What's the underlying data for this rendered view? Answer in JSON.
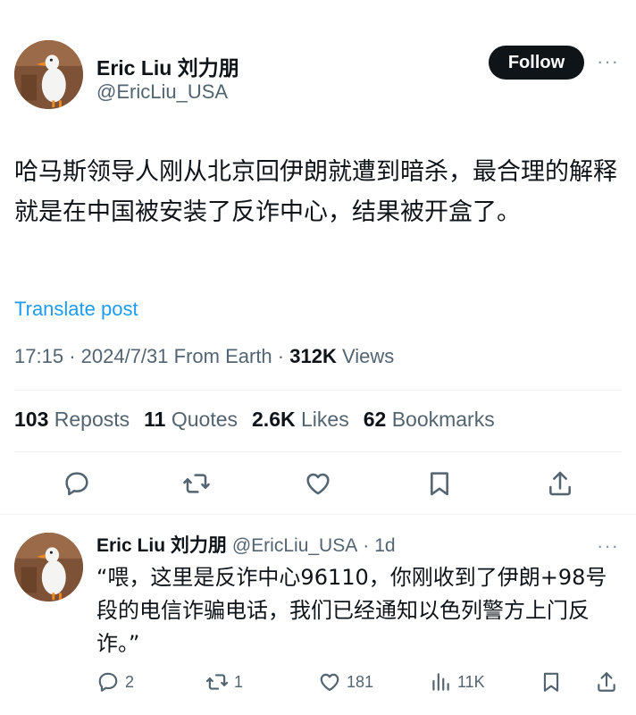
{
  "post": {
    "author": {
      "name": "Eric Liu 刘力朋",
      "handle": "@EricLiu_USA"
    },
    "follow_label": "Follow",
    "text": "哈马斯领导人刚从北京回伊朗就遭到暗杀，最合理的解释就是在中国被安装了反诈中心，结果被开盒了。",
    "translate_label": "Translate post",
    "meta": {
      "time": "17:15",
      "date": "2024/7/31",
      "source": "From Earth",
      "views_count": "312K",
      "views_label": "Views"
    },
    "stats": {
      "reposts": "103",
      "reposts_label": "Reposts",
      "quotes": "11",
      "quotes_label": "Quotes",
      "likes": "2.6K",
      "likes_label": "Likes",
      "bookmarks": "62",
      "bookmarks_label": "Bookmarks"
    },
    "actions": [
      "reply-icon",
      "repost-icon",
      "like-icon",
      "bookmark-icon",
      "share-icon"
    ]
  },
  "reply": {
    "author": {
      "name": "Eric Liu 刘力朋",
      "handle": "@EricLiu_USA",
      "age": "1d"
    },
    "text": "“喂，这里是反诈中心96110，你刚收到了伊朗+98号段的电信诈骗电话，我们已经通知以色列警方上门反诈。”",
    "counts": {
      "replies": "2",
      "reposts": "1",
      "likes": "181",
      "views": "11K"
    }
  },
  "colors": {
    "text": "#0f1419",
    "secondary": "#536471",
    "link": "#1d9bf0",
    "button": "#0f1419"
  }
}
